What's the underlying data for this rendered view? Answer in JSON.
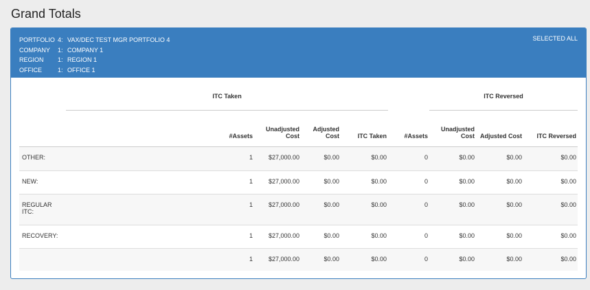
{
  "page": {
    "title": "Grand Totals"
  },
  "header": {
    "filters": [
      {
        "label": "PORTFOLIO",
        "num": "4:",
        "value": "VAX/DEC TEST MGR PORTFOLIO 4"
      },
      {
        "label": "COMPANY",
        "num": "1:",
        "value": "COMPANY 1"
      },
      {
        "label": "REGION",
        "num": "1:",
        "value": "REGION 1"
      },
      {
        "label": "OFFICE",
        "num": "1:",
        "value": "OFFICE 1"
      }
    ],
    "selected": "SELECTED ALL"
  },
  "table": {
    "groups": {
      "taken": "ITC Taken",
      "reversed": "ITC Reversed"
    },
    "columns": [
      "#Assets",
      "Unadjusted Cost",
      "Adjusted Cost",
      "ITC Taken",
      "#Assets",
      "Unadjusted Cost",
      "Adjusted Cost",
      "ITC Reversed"
    ],
    "rows": [
      {
        "label": "OTHER:",
        "cells": [
          "1",
          "$27,000.00",
          "$0.00",
          "$0.00",
          "0",
          "$0.00",
          "$0.00",
          "$0.00"
        ]
      },
      {
        "label": "NEW:",
        "cells": [
          "1",
          "$27,000.00",
          "$0.00",
          "$0.00",
          "0",
          "$0.00",
          "$0.00",
          "$0.00"
        ]
      },
      {
        "label": "REGULAR ITC:",
        "cells": [
          "1",
          "$27,000.00",
          "$0.00",
          "$0.00",
          "0",
          "$0.00",
          "$0.00",
          "$0.00"
        ]
      },
      {
        "label": "RECOVERY:",
        "cells": [
          "1",
          "$27,000.00",
          "$0.00",
          "$0.00",
          "0",
          "$0.00",
          "$0.00",
          "$0.00"
        ]
      },
      {
        "label": "",
        "cells": [
          "1",
          "$27,000.00",
          "$0.00",
          "$0.00",
          "0",
          "$0.00",
          "$0.00",
          "$0.00"
        ]
      }
    ]
  }
}
